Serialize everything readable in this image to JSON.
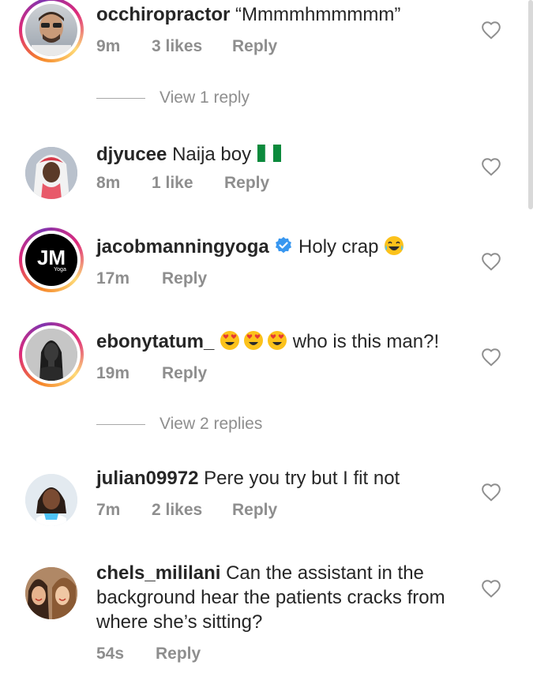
{
  "comments": [
    {
      "username": "occhiropractor",
      "text": "“Mmmmhmmmmm”",
      "time": "9m",
      "likes": "3 likes",
      "reply": "Reply",
      "view_replies": "View 1 reply"
    },
    {
      "username": "djyucee",
      "text": "Naija boy",
      "time": "8m",
      "likes": "1 like",
      "reply": "Reply"
    },
    {
      "username": "jacobmanningyoga",
      "text": "Holy crap",
      "time": "17m",
      "reply": "Reply",
      "avatar_text": "JM",
      "avatar_sub": "Yoga"
    },
    {
      "username": "ebonytatum_",
      "text": "who is this man?!",
      "time": "19m",
      "reply": "Reply",
      "view_replies": "View 2 replies"
    },
    {
      "username": "julian09972",
      "text": "Pere you try but I fit not",
      "time": "7m",
      "likes": "2 likes",
      "reply": "Reply"
    },
    {
      "username": "chels_mililani",
      "text": "Can the assistant in the background hear the patients cracks from where she’s sitting?",
      "time": "54s",
      "reply": "Reply"
    }
  ],
  "icons": {
    "like": "heart-outline-icon",
    "verified": "verified-badge-icon",
    "flag": "nigeria-flag-emoji",
    "laugh": "tears-of-joy-emoji",
    "love": "heart-eyes-emoji"
  },
  "colors": {
    "verified": "#3897f0",
    "meta_text": "#8e8e8e",
    "story_ring_start": "#f58529",
    "story_ring_end": "#dd2a7b"
  }
}
